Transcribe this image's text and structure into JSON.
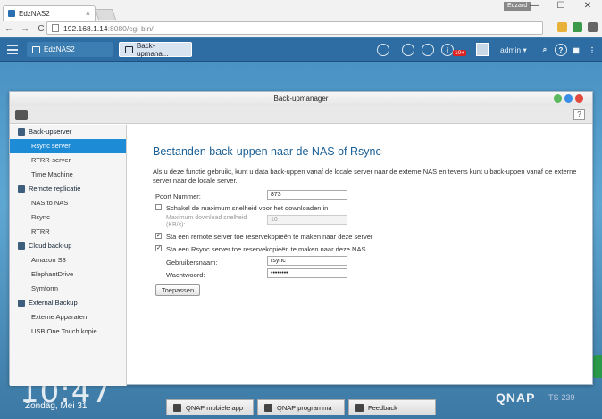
{
  "browser": {
    "tab_title": "EdzNAS2",
    "tab_close": "×",
    "user_badge": "Edzard",
    "url_host": "192.168.1.14",
    "url_rest": ":8080/cgi-bin/",
    "minimize": "—",
    "maximize": "☐",
    "close": "✕",
    "back": "←",
    "forward": "→",
    "reload": "C"
  },
  "qts_bar": {
    "tab1_label": "EdzNAS2",
    "tab2_label": "Back-upmana...",
    "notification_count": "10+",
    "user_label": "admin ▾",
    "colors": {
      "bar": "#2d6da3",
      "active_item": "#1e8bd6"
    }
  },
  "window": {
    "title": "Back-upmanager",
    "help": "?",
    "sidebar": [
      {
        "type": "section",
        "label": "Back-upserver",
        "icon": "server-icon"
      },
      {
        "type": "item",
        "label": "Rsync server",
        "active": true
      },
      {
        "type": "item",
        "label": "RTRR-server"
      },
      {
        "type": "item",
        "label": "Time Machine"
      },
      {
        "type": "section",
        "label": "Remote replicatie",
        "icon": "replication-icon"
      },
      {
        "type": "item",
        "label": "NAS to NAS"
      },
      {
        "type": "item",
        "label": "Rsync"
      },
      {
        "type": "item",
        "label": "RTRR"
      },
      {
        "type": "section",
        "label": "Cloud back-up",
        "icon": "cloud-icon"
      },
      {
        "type": "item",
        "label": "Amazon S3"
      },
      {
        "type": "item",
        "label": "ElephantDrive"
      },
      {
        "type": "item",
        "label": "Symform"
      },
      {
        "type": "section",
        "label": "External Backup",
        "icon": "usb-icon"
      },
      {
        "type": "item",
        "label": "Externe Apparaten"
      },
      {
        "type": "item",
        "label": "USB One Touch kopie"
      }
    ],
    "main": {
      "heading": "Bestanden back-uppen naar de NAS of Rsync",
      "description": "Als u deze functie gebruikt, kunt u data back-uppen vanaf de locale server naar de externe NAS en tevens kunt u back-uppen vanaf de externe server naar de locale server.",
      "port_label": "Poort Nummer:",
      "port_value": "873",
      "max_speed_label": "Schakel de maximum snelheid voor het downloaden in",
      "max_speed_checked": false,
      "max_download_label": "Maximum download snelheid (KB/s):",
      "max_download_value": "10",
      "allow_remote_label": "Sta een remote server toe reservekopieën te maken naar deze server",
      "allow_remote_checked": true,
      "allow_rsync_label": "Sta een Rsync server toe reservekopieën te maken naar deze NAS",
      "allow_rsync_checked": true,
      "username_label": "Gebruikersnaam:",
      "username_value": "rsync",
      "password_label": "Wachtwoord:",
      "password_value": "••••••••",
      "apply_label": "Toepassen"
    }
  },
  "desktop": {
    "clock": "10:47",
    "date": "Zondag, Mei 31",
    "brand": "QNAP",
    "model": "TS-239",
    "taskbar": [
      "QNAP mobiele app",
      "QNAP programma",
      "Feedback"
    ]
  }
}
